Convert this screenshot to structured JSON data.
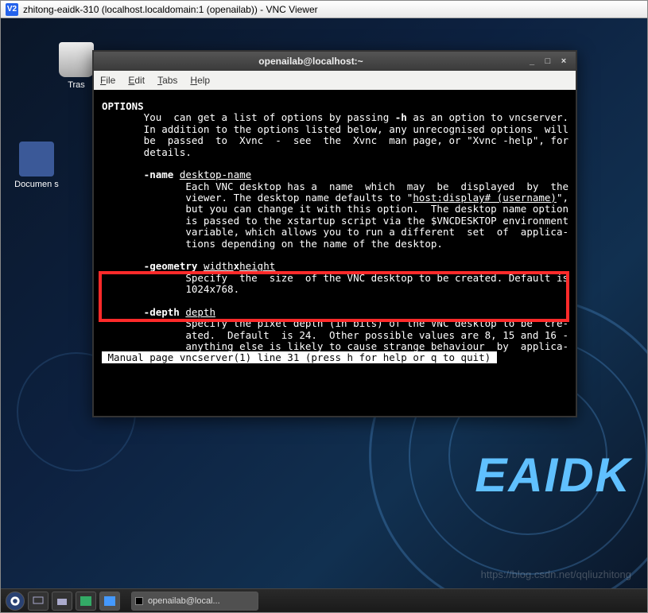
{
  "vnc": {
    "icon_text": "V2",
    "title": "zhitong-eaidk-310 (localhost.localdomain:1 (openailab)) - VNC Viewer"
  },
  "desktop_icons": {
    "trash": "Tras",
    "documents": "Documen\n  s"
  },
  "terminal": {
    "title": "openailab@localhost:~",
    "menus": {
      "file": "File",
      "edit": "Edit",
      "tabs": "Tabs",
      "help": "Help"
    },
    "win_controls": {
      "min": "_",
      "max": "□",
      "close": "×"
    },
    "text": {
      "options_hdr": "OPTIONS",
      "intro1": "       You  can get a list of options by passing ",
      "intro_flag": "-h",
      "intro1b": " as an option to vncserver.",
      "intro2": "       In addition to the options listed below, any unrecognised options  will",
      "intro3": "       be  passed  to  Xvnc  -  see  the  Xvnc  man page, or \"Xvnc -help\", for",
      "intro4": "       details.",
      "name_flag": "       -name ",
      "name_arg": "desktop-name",
      "name1": "              Each VNC desktop has a  name  which  may  be  displayed  by  the",
      "name2a": "              viewer. The desktop name defaults to \"",
      "name2_u": "host:display# (username)",
      "name2b": "\",",
      "name3": "              but you can change it with this option.  The desktop name option",
      "name4": "              is passed to the xstartup script via the $VNCDESKTOP environment",
      "name5": "              variable, which allows you to run a different  set  of  applica-",
      "name6": "              tions depending on the name of the desktop.",
      "geom_flag": "       -geometry ",
      "geom_argw": "width",
      "geom_x": "x",
      "geom_argh": "height",
      "geom1": "              Specify  the  size  of the VNC desktop to be created. Default is",
      "geom2": "              1024x768.",
      "depth_flag": "       -depth ",
      "depth_arg": "depth",
      "depth1": "              Specify the pixel depth (in bits) of the VNC desktop to be  cre-",
      "depth2": "              ated.  Default  is 24.  Other possible values are 8, 15 and 16 -",
      "depth3": "              anything else is likely to cause strange behaviour  by  applica-",
      "status": " Manual page vncserver(1) line 31 (press h for help or q to quit) "
    }
  },
  "taskbar": {
    "task_label": "openailab@local..."
  },
  "brand": "EAIDK",
  "watermark": "https://blog.csdn.net/qqliuzhitong"
}
